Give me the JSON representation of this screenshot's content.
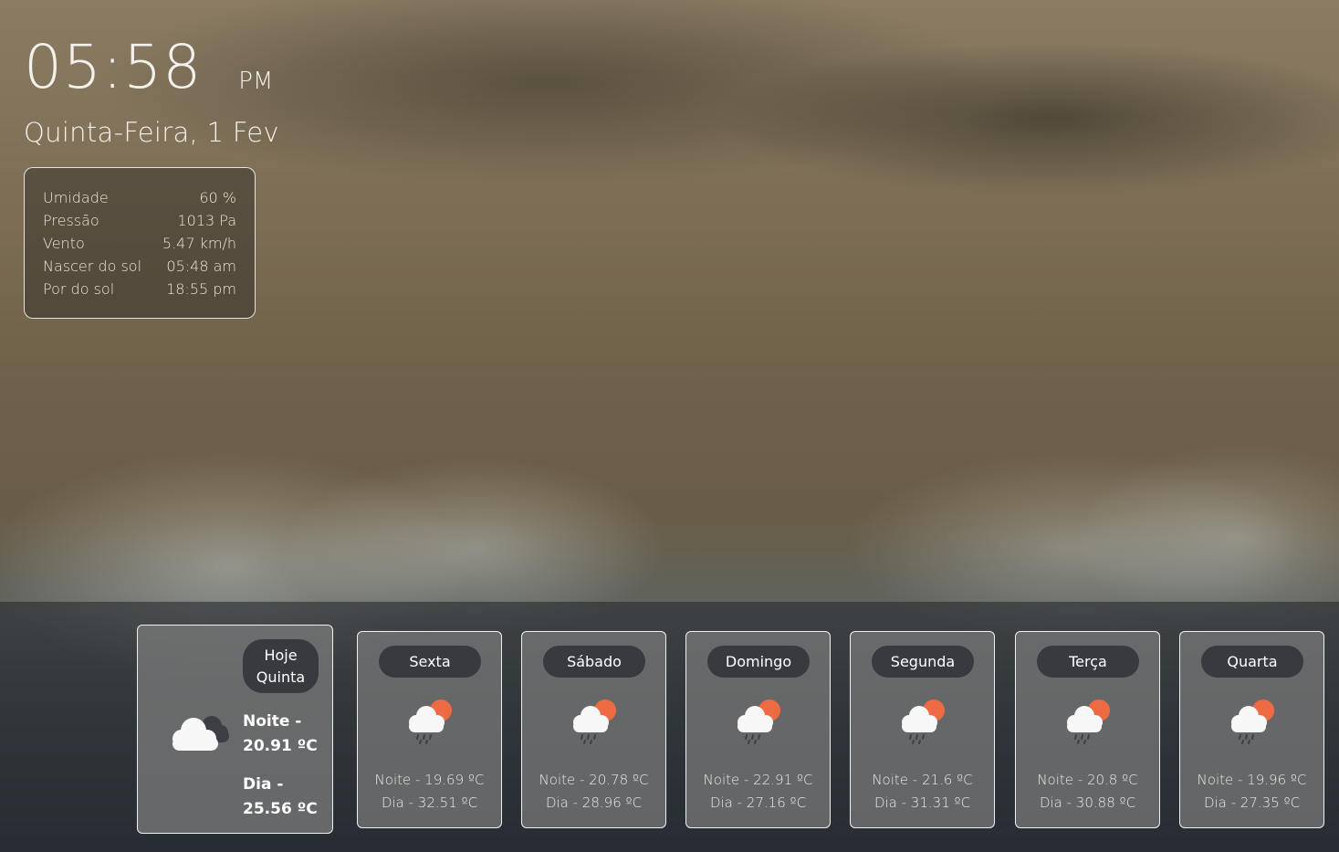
{
  "clock": {
    "time": "05:58",
    "ampm": "PM"
  },
  "date": "Quinta-Feira, 1 Fev",
  "details": [
    {
      "label": "Umidade",
      "value": "60 %"
    },
    {
      "label": "Pressão",
      "value": "1013 Pa"
    },
    {
      "label": "Vento",
      "value": "5.47 km/h"
    },
    {
      "label": "Nascer do sol",
      "value": "05:48 am"
    },
    {
      "label": "Por do sol",
      "value": "18:55 pm"
    }
  ],
  "today": {
    "line1": "Hoje",
    "line2": "Quinta",
    "icon": "cloudy-icon",
    "night_label": "Noite -",
    "night_temp": "20.91 ºC",
    "day_label": "Dia -",
    "day_temp": "25.56 ºC"
  },
  "forecast": [
    {
      "day": "Sexta",
      "icon": "rain-sun-icon",
      "night": "Noite - 19.69 ºC",
      "dayTemp": "Dia - 32.51 ºC"
    },
    {
      "day": "Sábado",
      "icon": "rain-sun-icon",
      "night": "Noite - 20.78 ºC",
      "dayTemp": "Dia - 28.96 ºC"
    },
    {
      "day": "Domingo",
      "icon": "rain-sun-icon",
      "night": "Noite - 22.91 ºC",
      "dayTemp": "Dia - 27.16 ºC"
    },
    {
      "day": "Segunda",
      "icon": "rain-sun-icon",
      "night": "Noite - 21.6 ºC",
      "dayTemp": "Dia - 31.31 ºC"
    },
    {
      "day": "Terça",
      "icon": "rain-sun-icon",
      "night": "Noite - 20.8 ºC",
      "dayTemp": "Dia - 30.88 ºC"
    },
    {
      "day": "Quarta",
      "icon": "rain-sun-icon",
      "night": "Noite - 19.96 ºC",
      "dayTemp": "Dia - 27.35 ºC"
    }
  ],
  "colors": {
    "sun": "#ee6a43",
    "pill": "#393a40"
  }
}
